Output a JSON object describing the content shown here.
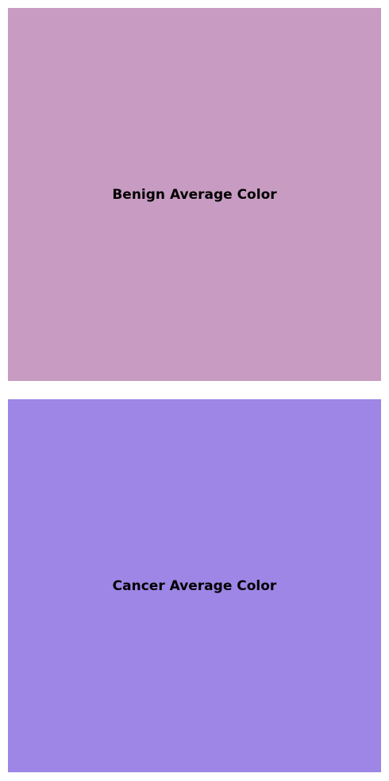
{
  "swatches": [
    {
      "label": "Benign Average Color",
      "color": "#c89cc2"
    },
    {
      "label": "Cancer Average Color",
      "color": "#9d86e5"
    }
  ]
}
